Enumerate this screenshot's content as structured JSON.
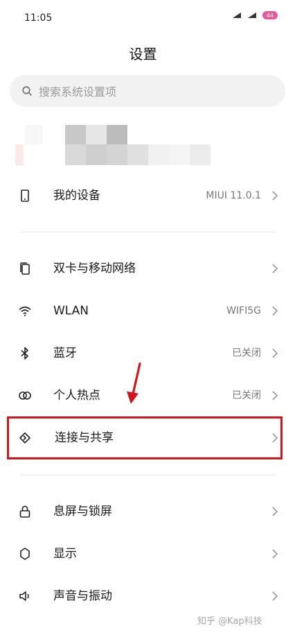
{
  "status_bar": {
    "time": "11:05",
    "battery": "44"
  },
  "page_title": "设置",
  "search": {
    "placeholder": "搜索系统设置项"
  },
  "sections": {
    "device": {
      "label": "我的设备",
      "value": "MIUI 11.0.1"
    },
    "connectivity": [
      {
        "id": "sim",
        "label": "双卡与移动网络",
        "value": ""
      },
      {
        "id": "wlan",
        "label": "WLAN",
        "value": "WIFI5G"
      },
      {
        "id": "bluetooth",
        "label": "蓝牙",
        "value": "已关闭"
      },
      {
        "id": "hotspot",
        "label": "个人热点",
        "value": "已关闭"
      },
      {
        "id": "share",
        "label": "连接与共享",
        "value": ""
      }
    ],
    "display": [
      {
        "id": "lock",
        "label": "息屏与锁屏"
      },
      {
        "id": "display",
        "label": "显示"
      },
      {
        "id": "sound",
        "label": "声音与振动"
      }
    ]
  },
  "watermark": "知乎 @Kap科技",
  "colors": {
    "highlight": "#d0161c",
    "muted": "#777777"
  },
  "icons": {
    "device": "phone-icon",
    "sim": "sim-cards-icon",
    "wlan": "wifi-icon",
    "bluetooth": "bluetooth-icon",
    "hotspot": "hotspot-icon",
    "share": "connection-share-icon",
    "lock": "lock-icon",
    "display": "brightness-icon",
    "sound": "speaker-icon"
  }
}
